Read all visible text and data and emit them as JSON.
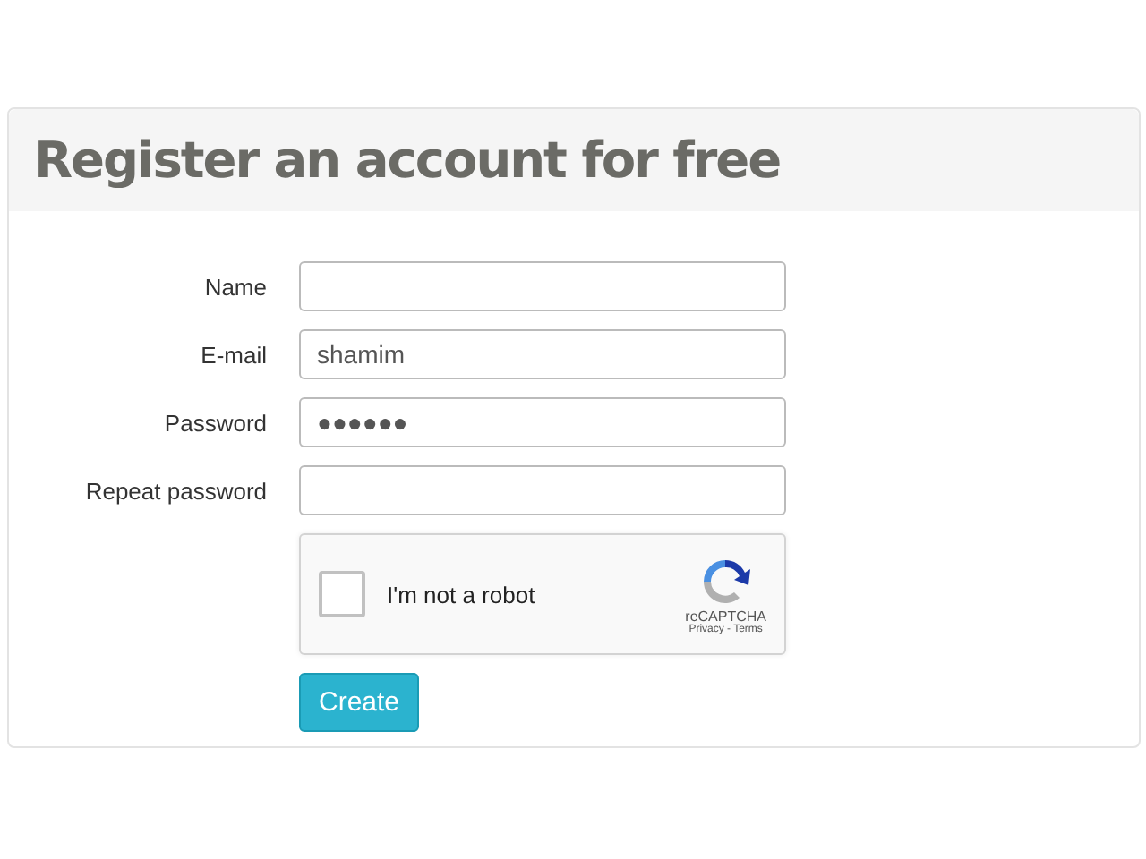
{
  "panel": {
    "title": "Register an account for free"
  },
  "fields": [
    {
      "label": "Name"
    },
    {
      "label": "E-mail",
      "value": "shamim"
    },
    {
      "label": "Password",
      "value": "●●●●●●"
    },
    {
      "label": "Repeat password"
    }
  ],
  "captcha": {
    "checked": false,
    "label": "I'm not a robot",
    "brand": "reCAPTCHA",
    "links": "Privacy - Terms"
  },
  "submit": {
    "label": "Create"
  }
}
